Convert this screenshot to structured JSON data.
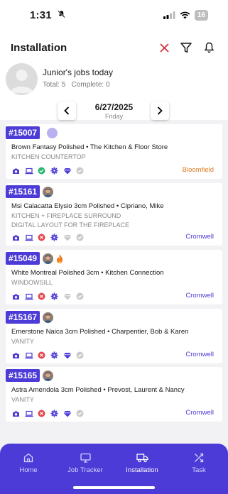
{
  "status_bar": {
    "time": "1:31",
    "battery": "16"
  },
  "header": {
    "title": "Installation",
    "icons": [
      "close-icon",
      "filter-icon",
      "bell-icon"
    ],
    "user_line": "Junior's jobs today",
    "stats": {
      "total_label": "Total:",
      "total": "5",
      "complete_label": "Complete:",
      "complete": "0"
    },
    "date": "6/27/2025",
    "weekday": "Friday"
  },
  "jobs": [
    {
      "number": "#15007",
      "line1": "Brown Fantasy Polished • The Kitchen & Floor Store",
      "sub": [
        "KITCHEN COUNTERTOP"
      ],
      "location": "Bloomfield",
      "location_color": "#e07a1f",
      "extra": "purple-dot",
      "statuses": [
        "camera",
        "laptop",
        "check-green",
        "gear",
        "diamond",
        "check-grey"
      ]
    },
    {
      "number": "#15161",
      "line1": "Msi Calacatta Elysio 3cm Polished • Cipriano, Mike",
      "sub": [
        "KITCHEN + FIREPLACE SURROUND",
        "DIGITAL LAYOUT FOR THE FIREPLACE"
      ],
      "location": "Cromwell",
      "location_color": "#4c3bd6",
      "extra": "avatar",
      "statuses": [
        "camera",
        "laptop",
        "x-red",
        "gear",
        "diamond-grey",
        "check-grey"
      ]
    },
    {
      "number": "#15049",
      "line1": "White Montreal Polished 3cm  • Kitchen Connection",
      "sub": [
        "WINDOWSILL"
      ],
      "location": "Cromwell",
      "location_color": "#4c3bd6",
      "extra": "avatar-fire",
      "statuses": [
        "camera",
        "laptop",
        "x-red",
        "gear",
        "diamond-grey",
        "check-grey"
      ]
    },
    {
      "number": "#15167",
      "line1": "Emerstone Naica 3cm Polished • Charpentier, Bob & Karen",
      "sub": [
        "VANITY"
      ],
      "location": "Cromwell",
      "location_color": "#4c3bd6",
      "extra": "avatar",
      "statuses": [
        "camera",
        "laptop",
        "x-red",
        "gear",
        "diamond",
        "check-grey"
      ]
    },
    {
      "number": "#15165",
      "line1": "Astra Amendola 3cm Polished • Prevost, Laurent & Nancy",
      "sub": [
        "VANITY"
      ],
      "location": "Cromwell",
      "location_color": "#4c3bd6",
      "extra": "avatar",
      "statuses": [
        "camera",
        "laptop",
        "x-red",
        "gear",
        "diamond",
        "check-grey"
      ]
    }
  ],
  "tabbar": {
    "tabs": [
      {
        "label": "Home",
        "icon": "home-icon",
        "active": false
      },
      {
        "label": "Job Tracker",
        "icon": "monitor-icon",
        "active": false
      },
      {
        "label": "Installation",
        "icon": "truck-icon",
        "active": true
      },
      {
        "label": "Task",
        "icon": "shuffle-icon",
        "active": false
      }
    ]
  },
  "colors": {
    "accent": "#4c3bd6",
    "orange": "#e07a1f",
    "green": "#2bb673",
    "red": "#e5484d"
  }
}
